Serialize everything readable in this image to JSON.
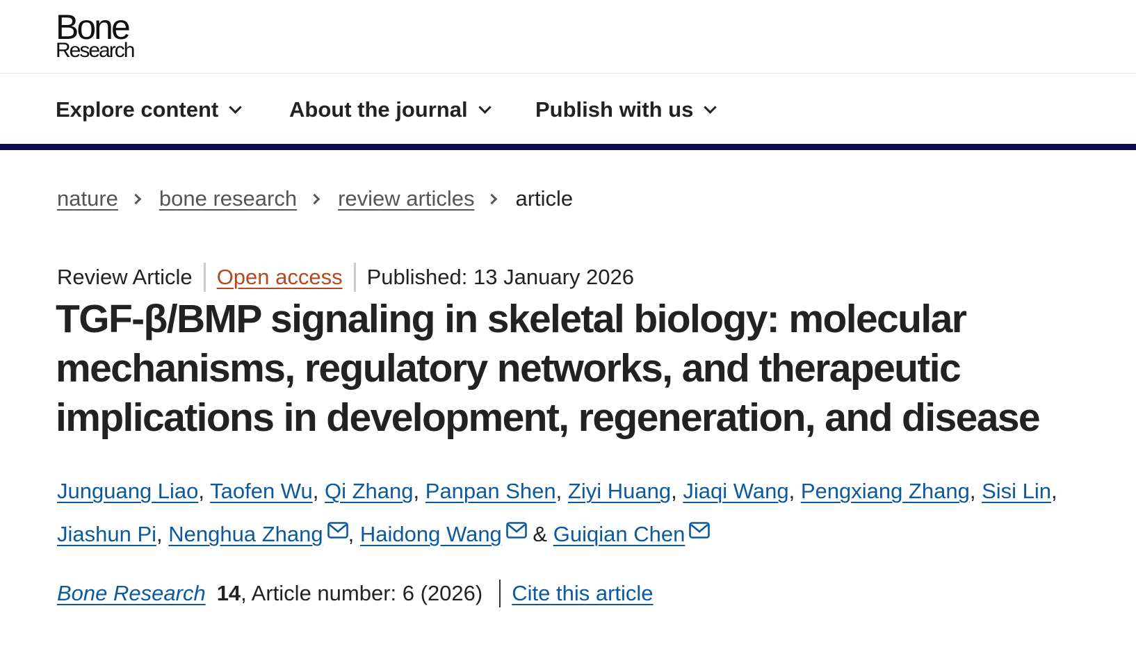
{
  "header": {
    "logo_line1": "Bone",
    "logo_line2": "Research"
  },
  "nav": {
    "items": [
      {
        "label": "Explore content"
      },
      {
        "label": "About the journal"
      },
      {
        "label": "Publish with us"
      }
    ]
  },
  "breadcrumb": {
    "items": [
      "nature",
      "bone research",
      "review articles"
    ],
    "current": "article"
  },
  "meta": {
    "article_type": "Review Article",
    "open_access": "Open access",
    "published": "Published: 13 January 2026"
  },
  "article": {
    "title": "TGF-β/BMP signaling in skeletal biology: molecular mechanisms, regulatory networks, and therapeutic implications in development, regeneration, and disease"
  },
  "authors": [
    {
      "name": "Junguang Liao"
    },
    {
      "name": "Taofen Wu"
    },
    {
      "name": "Qi Zhang"
    },
    {
      "name": "Panpan Shen"
    },
    {
      "name": "Ziyi Huang"
    },
    {
      "name": "Jiaqi Wang"
    },
    {
      "name": "Pengxiang Zhang"
    },
    {
      "name": "Sisi Lin"
    },
    {
      "name": "Jiashun Pi"
    },
    {
      "name": "Nenghua Zhang"
    },
    {
      "name": "Haidong Wang"
    },
    {
      "name": "Guiqian Chen"
    }
  ],
  "authors_separators": {
    "comma": ",",
    "ampersand": "&"
  },
  "citation": {
    "journal": "Bone Research",
    "volume": "14",
    "rest": ", Article number: 6 (2026)",
    "cite_link": "Cite this article"
  },
  "icons": {
    "nav_chevron": "chevron-down-icon",
    "breadcrumb_sep": "chevron-right-icon",
    "mail": "mail-icon"
  },
  "colors": {
    "nav_bar": "#0c0d52",
    "link": "#0b5aa0",
    "open_access": "#b5481e",
    "text": "#222222"
  }
}
